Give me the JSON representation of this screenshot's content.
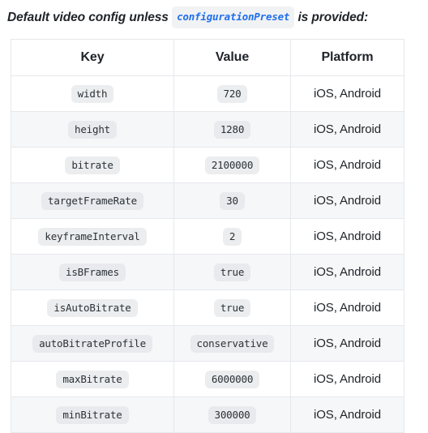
{
  "caption": {
    "before": "Default video config unless",
    "code": "configurationPreset",
    "after": "is provided:"
  },
  "table": {
    "headers": [
      "Key",
      "Value",
      "Platform"
    ],
    "rows": [
      {
        "key": "width",
        "value": "720",
        "platform": "iOS, Android"
      },
      {
        "key": "height",
        "value": "1280",
        "platform": "iOS, Android"
      },
      {
        "key": "bitrate",
        "value": "2100000",
        "platform": "iOS, Android"
      },
      {
        "key": "targetFrameRate",
        "value": "30",
        "platform": "iOS, Android"
      },
      {
        "key": "keyframeInterval",
        "value": "2",
        "platform": "iOS, Android"
      },
      {
        "key": "isBFrames",
        "value": "true",
        "platform": "iOS, Android"
      },
      {
        "key": "isAutoBitrate",
        "value": "true",
        "platform": "iOS, Android"
      },
      {
        "key": "autoBitrateProfile",
        "value": "conservative",
        "platform": "iOS, Android"
      },
      {
        "key": "maxBitrate",
        "value": "6000000",
        "platform": "iOS, Android"
      },
      {
        "key": "minBitrate",
        "value": "300000",
        "platform": "iOS, Android"
      }
    ]
  },
  "colors": {
    "code_text": "#1f6feb",
    "chip_bg": "#ebedef",
    "row_alt_bg": "#f6f7f9",
    "border": "#e6e8ec",
    "text": "#1f2328"
  }
}
